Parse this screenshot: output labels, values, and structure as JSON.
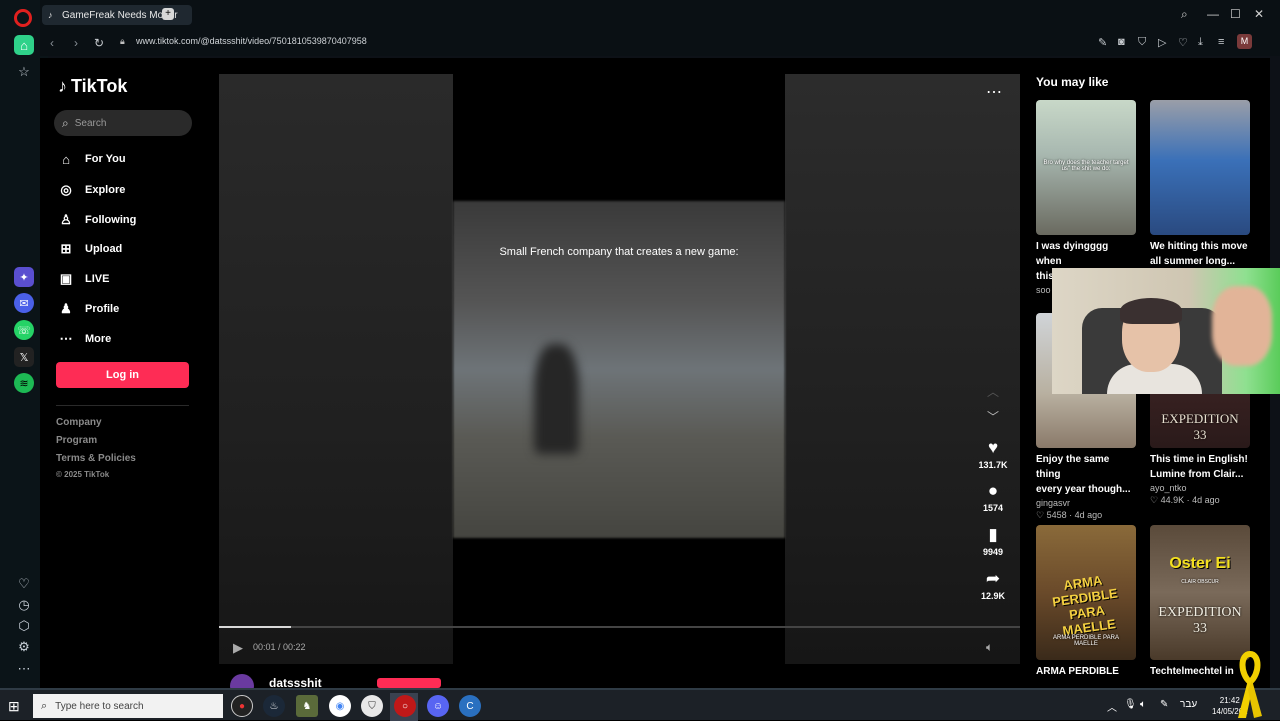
{
  "browser": {
    "tab_title": "GameFreak Needs Moder",
    "url": "www.tiktok.com/@datssshit/video/7501810539870407958",
    "avatar_letter": "M"
  },
  "sidebar": {
    "logo": "TikTok",
    "search_placeholder": "Search",
    "items": [
      {
        "label": "For You",
        "icon": "home-icon"
      },
      {
        "label": "Explore",
        "icon": "compass-icon"
      },
      {
        "label": "Following",
        "icon": "following-icon"
      },
      {
        "label": "Upload",
        "icon": "upload-icon"
      },
      {
        "label": "LIVE",
        "icon": "live-icon"
      },
      {
        "label": "Profile",
        "icon": "profile-icon"
      },
      {
        "label": "More",
        "icon": "more-icon"
      }
    ],
    "login": "Log in",
    "footer": [
      "Company",
      "Program",
      "Terms & Policies"
    ],
    "copyright": "© 2025 TikTok"
  },
  "video": {
    "caption": "Small French company that creates a new game:",
    "likes": "131.7K",
    "comments": "1574",
    "saves": "9949",
    "shares": "12.9K",
    "time": "00:01 / 00:22",
    "progress_fraction": 0.09,
    "author": "datssshit"
  },
  "recommendations": {
    "title": "You may like",
    "cards": [
      {
        "title1": "I was dyingggg when",
        "title2": "this happened",
        "author": "soo",
        "stats": "",
        "thumb_text": "Bro why does the teacher target us\" the shit we do:"
      },
      {
        "title1": "We hitting this move",
        "title2": "all summer long...",
        "author": "",
        "stats": "",
        "thumb_text": ""
      },
      {
        "title1": "Enjoy the same thing",
        "title2": "every year though...",
        "author": "gingasvr",
        "stats": "5458 · 4d ago",
        "thumb_text": ""
      },
      {
        "title1": "This time in English!",
        "title2": "Lumine from Clair...",
        "author": "ayo_ntko",
        "stats": "44.9K · 4d ago",
        "thumb_text": "EXPEDITION 33"
      },
      {
        "title1": "ARMA PERDIBLE",
        "title2": "",
        "author": "",
        "stats": "",
        "thumb_text": "ARMA PERDIBLE PARA MAELLE"
      },
      {
        "title1": "Techtelmechtel in",
        "title2": "",
        "author": "",
        "stats": "",
        "thumb_text": "Oster Ei"
      }
    ],
    "small_caption": "ARMA PERDIBLE PARA MAELLE",
    "expedition_text": "EXPEDITION 33",
    "clair_text": "CLAIR OBSCUR"
  },
  "taskbar": {
    "search_placeholder": "Type here to search",
    "lang": "עבר",
    "time": "21:42",
    "date": "14/05/202"
  },
  "colors": {
    "tiktok_red": "#fe2c55",
    "opera_red": "#e0201e"
  }
}
